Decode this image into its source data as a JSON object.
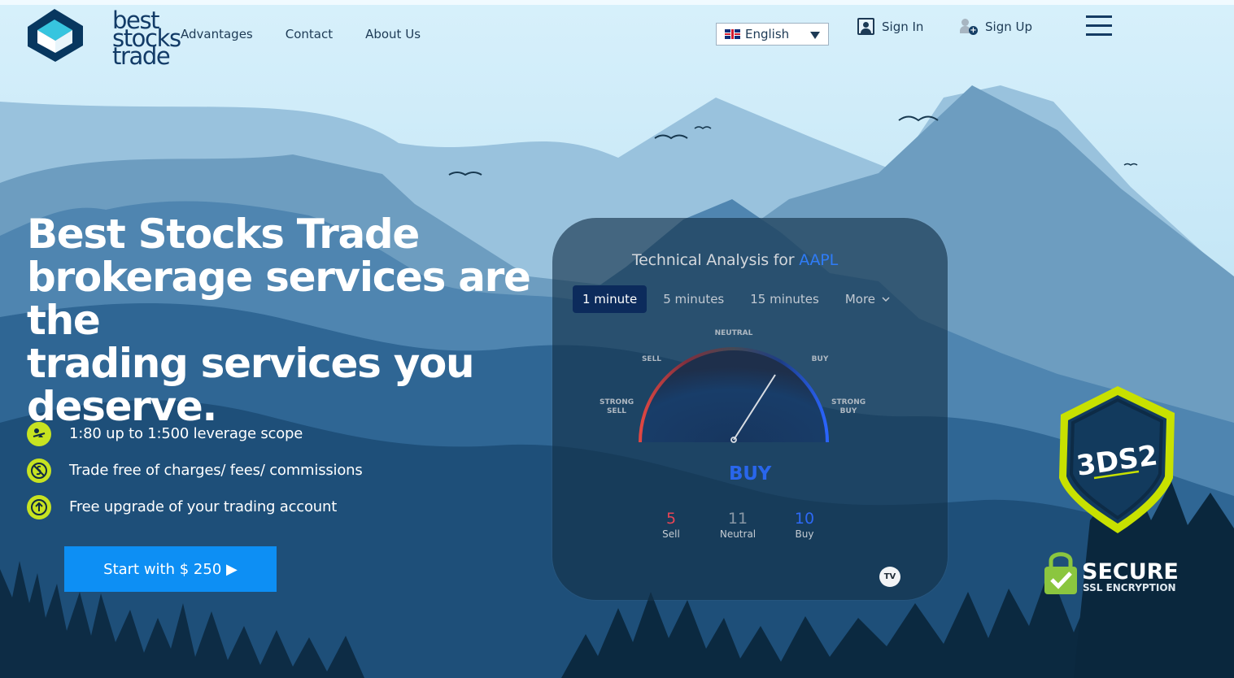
{
  "brand": {
    "logo_lines": [
      "best",
      "stocks",
      "trade"
    ]
  },
  "nav": [
    {
      "label": "Advantages"
    },
    {
      "label": "Contact"
    },
    {
      "label": "About Us"
    }
  ],
  "header": {
    "language": "English",
    "sign_in": "Sign In",
    "sign_up": "Sign Up"
  },
  "hero": {
    "title_lines": [
      "Best Stocks Trade",
      "brokerage services are the",
      "trading services you",
      "deserve."
    ],
    "features": [
      {
        "text": "1:80 up to 1:500 leverage scope",
        "icon": "leverage-icon"
      },
      {
        "text": "Trade free of charges/ fees/ commissions",
        "icon": "no-fees-icon"
      },
      {
        "text": "Free upgrade of your trading account",
        "icon": "upgrade-icon"
      }
    ],
    "cta": "Start with $ 250 ▶"
  },
  "widget": {
    "title_prefix": "Technical Analysis for",
    "symbol": "AAPL",
    "tabs": [
      {
        "label": "1 minute",
        "active": true
      },
      {
        "label": "5 minutes",
        "active": false
      },
      {
        "label": "15 minutes",
        "active": false
      }
    ],
    "more_label": "More",
    "gauge": {
      "labels": {
        "strong_sell": [
          "STRONG",
          "SELL"
        ],
        "sell": "SELL",
        "neutral": "NEUTRAL",
        "buy": "BUY",
        "strong_buy": [
          "STRONG",
          "BUY"
        ]
      },
      "needle_value": 0.7
    },
    "verdict": "BUY",
    "counts": [
      {
        "label": "Sell",
        "value": "5"
      },
      {
        "label": "Neutral",
        "value": "11"
      },
      {
        "label": "Buy",
        "value": "10"
      }
    ],
    "provider_mark": "TV"
  },
  "badges": {
    "three_ds": "3DS2",
    "secure": "SECURE",
    "ssl": "SSL ENCRYPTION"
  },
  "colors": {
    "cta": "#0d8ff4",
    "accent_green": "#c7e321",
    "buy_blue": "#2966ec",
    "sell_red": "#e84555",
    "dark_navy": "#123b67"
  }
}
